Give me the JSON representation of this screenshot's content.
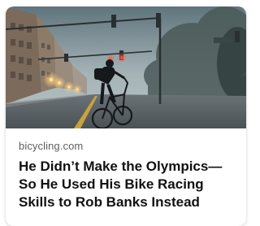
{
  "card": {
    "source": "bicycling.com",
    "headline": "He Didn’t Make the Olympics—So He Used His Bike Racing Skills to Rob Banks Instead",
    "image_description": ""
  },
  "colors": {
    "sky_top": "#6f848c",
    "sky_bottom": "#aebbbe",
    "traffic_light_red": "#ff4a3a",
    "street_light": "#ffcf6a",
    "lane_line": "#d3a63a"
  }
}
